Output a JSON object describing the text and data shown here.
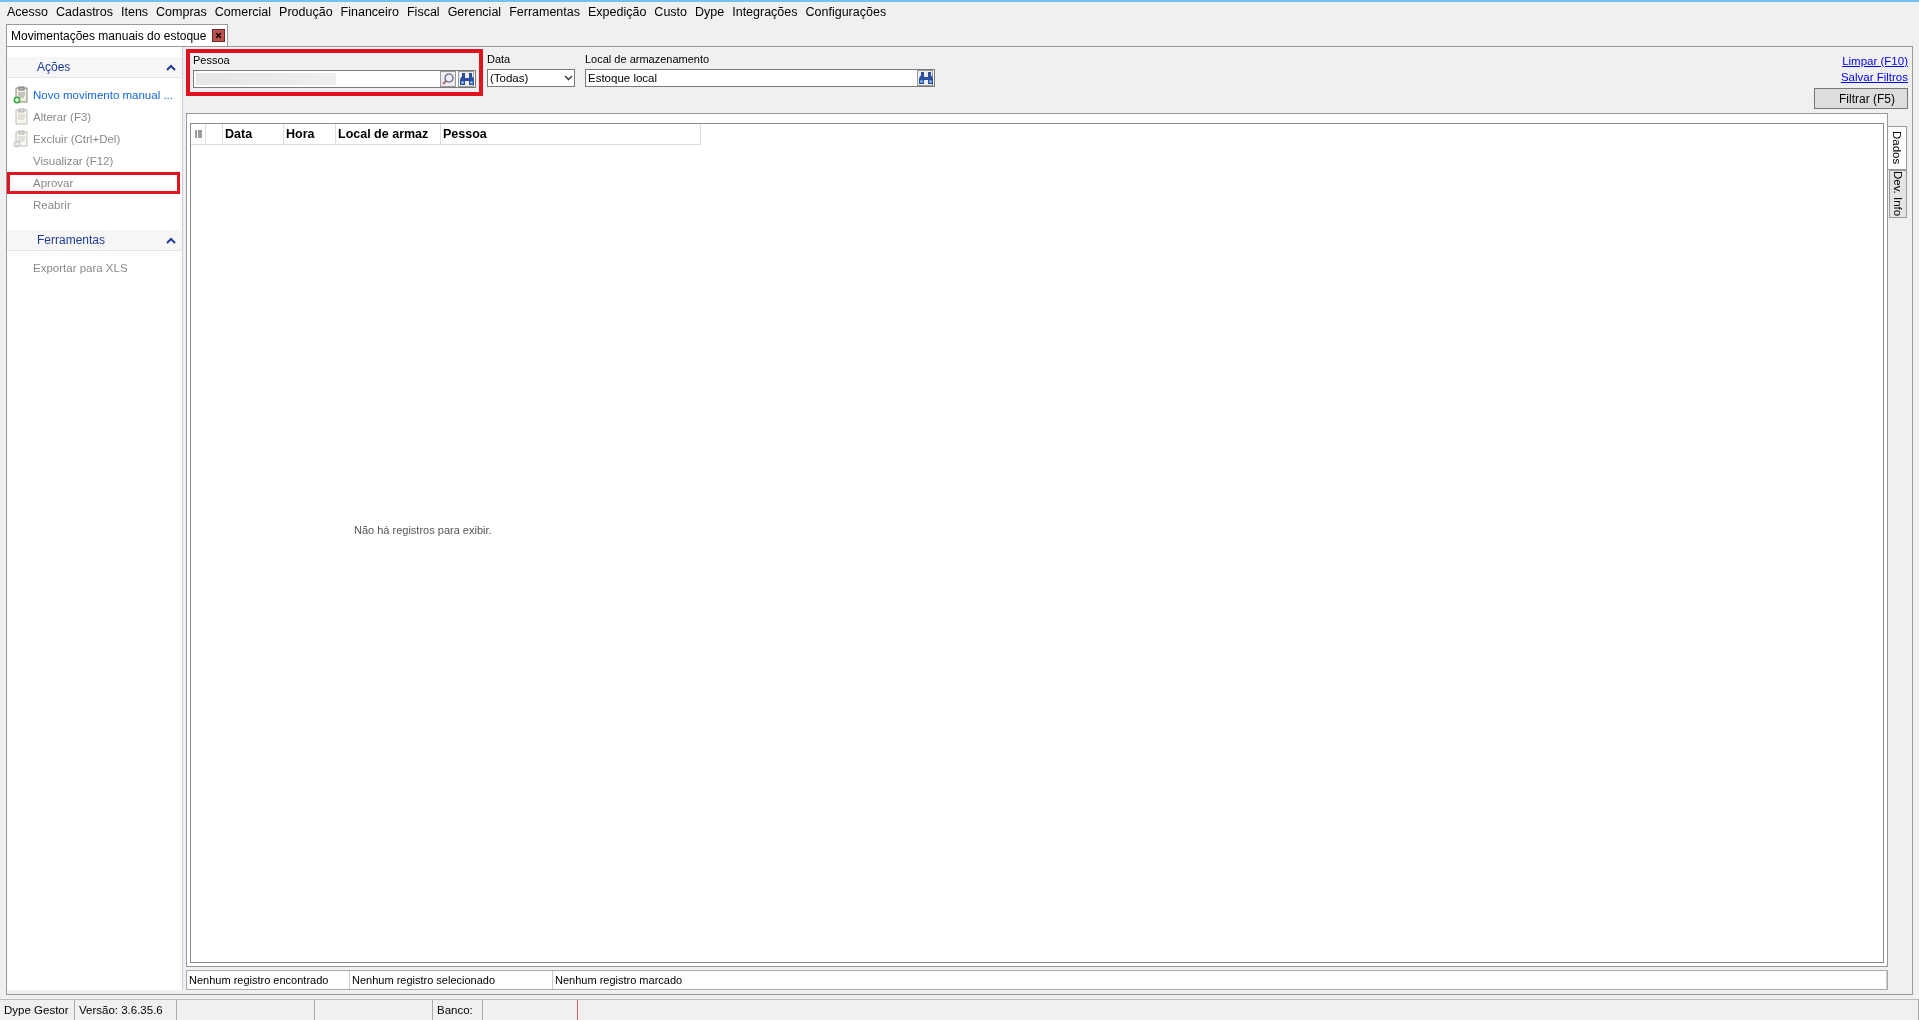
{
  "menu": [
    "Acesso",
    "Cadastros",
    "Itens",
    "Compras",
    "Comercial",
    "Produção",
    "Financeiro",
    "Fiscal",
    "Gerencial",
    "Ferramentas",
    "Expedição",
    "Custo",
    "Dype",
    "Integrações",
    "Configurações"
  ],
  "document_tab": {
    "title": "Movimentações manuais do estoque",
    "selected": true
  },
  "sidebar": {
    "groups": [
      {
        "title": "Ações",
        "expanded": true,
        "items": [
          {
            "label": "Novo movimento manual ...",
            "kind": "icon",
            "disabled": false,
            "highlighted": false
          },
          {
            "label": "Alterar (F3)",
            "kind": "icon",
            "disabled": true,
            "highlighted": false
          },
          {
            "label": "Excluir (Ctrl+Del)",
            "kind": "icon",
            "disabled": true,
            "highlighted": false
          },
          {
            "label": "Visualizar (F12)",
            "kind": "plain",
            "disabled": true,
            "highlighted": false
          },
          {
            "label": "Aprovar",
            "kind": "plain",
            "disabled": true,
            "highlighted": true
          },
          {
            "label": "Reabrir",
            "kind": "plain",
            "disabled": true,
            "highlighted": false
          }
        ]
      },
      {
        "title": "Ferramentas",
        "expanded": true,
        "items": [
          {
            "label": "Exportar para XLS",
            "kind": "plain",
            "disabled": true,
            "highlighted": false
          }
        ]
      }
    ]
  },
  "filters": {
    "pessoa": {
      "label": "Pessoa",
      "highlighted": true
    },
    "data": {
      "label": "Data",
      "value": "(Todas)"
    },
    "local": {
      "label": "Local de armazenamento",
      "value": "Estoque local"
    },
    "links": [
      "Limpar (F10)",
      "Salvar Filtros"
    ],
    "filter_button": "Filtrar (F5)"
  },
  "grid": {
    "columns": [
      "Data",
      "Hora",
      "Local de armaz",
      "Pessoa"
    ],
    "empty_message": "Não há registros para exibir.",
    "side_tabs": [
      {
        "label": "Dados",
        "selected": true
      },
      {
        "label": "Dev. Info",
        "selected": false
      }
    ],
    "footer": [
      "Nenhum registro encontrado",
      "Nenhum registro selecionado",
      "Nenhum registro marcado"
    ]
  },
  "status_bar": [
    "Dype Gestor",
    "Versão: 3.6.35.6",
    "Banco:"
  ]
}
